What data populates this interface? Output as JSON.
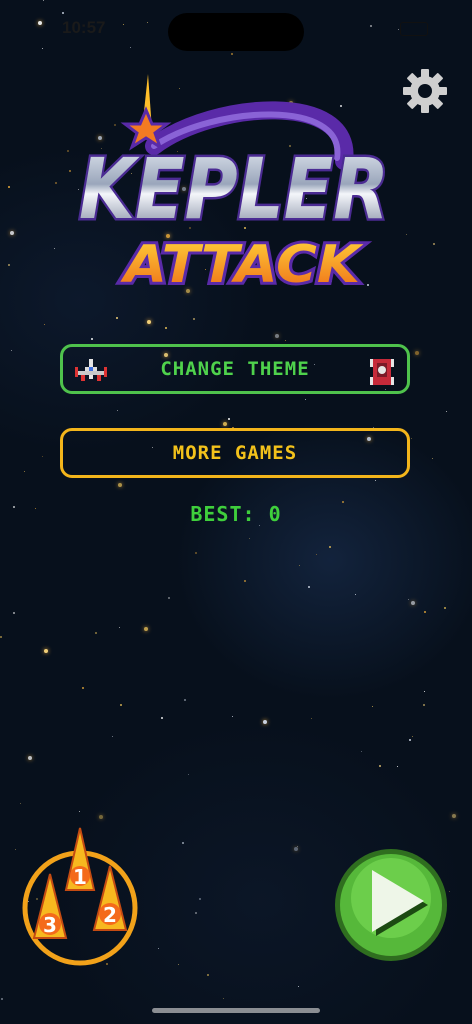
{
  "status_bar": {
    "time": "10:57"
  },
  "logo": {
    "line1": "KEPLER",
    "line2": "ATTACK"
  },
  "menu": {
    "change_theme": "CHANGE THEME",
    "more_games": "MORE GAMES"
  },
  "best": "BEST: 0",
  "ships_badge": {
    "n1": "1",
    "n2": "2",
    "n3": "3"
  },
  "colors": {
    "theme_green": "#4fc24c",
    "more_yellow": "#f3b51b",
    "best_green": "#3fcf3c",
    "play_green": "#56b83a"
  },
  "icons": {
    "settings": "gear-icon",
    "ship": "spaceship-icon",
    "alien": "alien-icon",
    "play": "play-icon",
    "ships": "fleet-icon"
  }
}
